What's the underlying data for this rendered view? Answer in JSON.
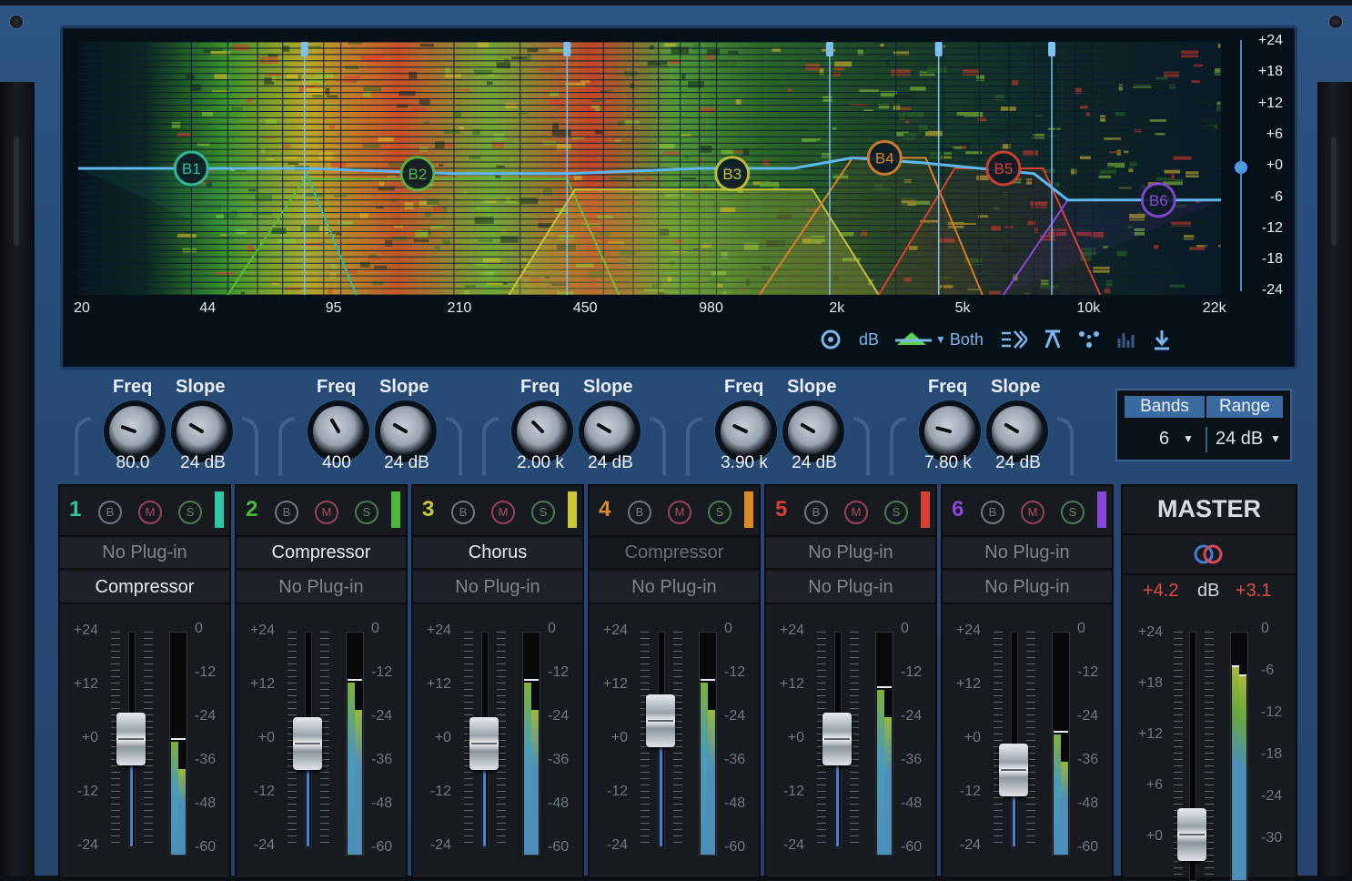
{
  "spectrum": {
    "freq_labels": [
      "20",
      "44",
      "95",
      "210",
      "450",
      "980",
      "2k",
      "5k",
      "10k",
      "22k"
    ],
    "db_labels": [
      "+24",
      "+18",
      "+12",
      "+6",
      "+0",
      "-6",
      "-12",
      "-18",
      "-24"
    ],
    "bands": [
      {
        "label": "B1",
        "color": "#2fbfa1"
      },
      {
        "label": "B2",
        "color": "#58b83c"
      },
      {
        "label": "B3",
        "color": "#c6c43a"
      },
      {
        "label": "B4",
        "color": "#d9812a"
      },
      {
        "label": "B5",
        "color": "#d9402f"
      },
      {
        "label": "B6",
        "color": "#8a46d8"
      }
    ],
    "toolbar": {
      "db_label": "dB",
      "mode_label": "Both"
    }
  },
  "crossovers": [
    {
      "freq_label": "Freq",
      "slope_label": "Slope",
      "freq": "80.0",
      "slope": "24 dB"
    },
    {
      "freq_label": "Freq",
      "slope_label": "Slope",
      "freq": "400",
      "slope": "24 dB"
    },
    {
      "freq_label": "Freq",
      "slope_label": "Slope",
      "freq": "2.00 k",
      "slope": "24 dB"
    },
    {
      "freq_label": "Freq",
      "slope_label": "Slope",
      "freq": "3.90 k",
      "slope": "24 dB"
    },
    {
      "freq_label": "Freq",
      "slope_label": "Slope",
      "freq": "7.80 k",
      "slope": "24 dB"
    }
  ],
  "band_settings": {
    "bands_label": "Bands",
    "range_label": "Range",
    "bands_value": "6",
    "range_value": "24 dB"
  },
  "strips": [
    {
      "num": "1",
      "color": "#2fc9a6",
      "slot1": "No Plug-in",
      "slot2": "Compressor",
      "fader_level_db": 0,
      "meter_peak_db": -24
    },
    {
      "num": "2",
      "color": "#4fb83a",
      "slot1": "Compressor",
      "slot2": "No Plug-in",
      "fader_level_db": -1,
      "meter_peak_db": -8
    },
    {
      "num": "3",
      "color": "#c9c83a",
      "slot1": "Chorus",
      "slot2": "No Plug-in",
      "fader_level_db": -1,
      "meter_peak_db": -8
    },
    {
      "num": "4",
      "color": "#d98a2a",
      "slot1": "Compressor",
      "slot2": "No Plug-in",
      "fader_level_db": 4,
      "meter_peak_db": -8
    },
    {
      "num": "5",
      "color": "#d9402f",
      "slot1": "No Plug-in",
      "slot2": "No Plug-in",
      "fader_level_db": 0,
      "meter_peak_db": -10
    },
    {
      "num": "6",
      "color": "#8a46d8",
      "slot1": "No Plug-in",
      "slot2": "No Plug-in",
      "fader_level_db": -7,
      "meter_peak_db": -22
    }
  ],
  "strip_labels": {
    "bypass": "B",
    "mute": "M",
    "solo": "S"
  },
  "fader_scale": [
    "+24",
    "+12",
    "+0",
    "-12",
    "-24"
  ],
  "meter_scale": [
    "0",
    "-12",
    "-24",
    "-36",
    "-48",
    "-60"
  ],
  "master": {
    "title": "MASTER",
    "gain_left": "+4.2",
    "gain_unit": "dB",
    "gain_right": "+3.1",
    "fader_scale": [
      "+24",
      "+18",
      "+12",
      "+6",
      "+0"
    ],
    "meter_scale": [
      "0",
      "-6",
      "-12",
      "-18",
      "-24",
      "-30"
    ]
  }
}
